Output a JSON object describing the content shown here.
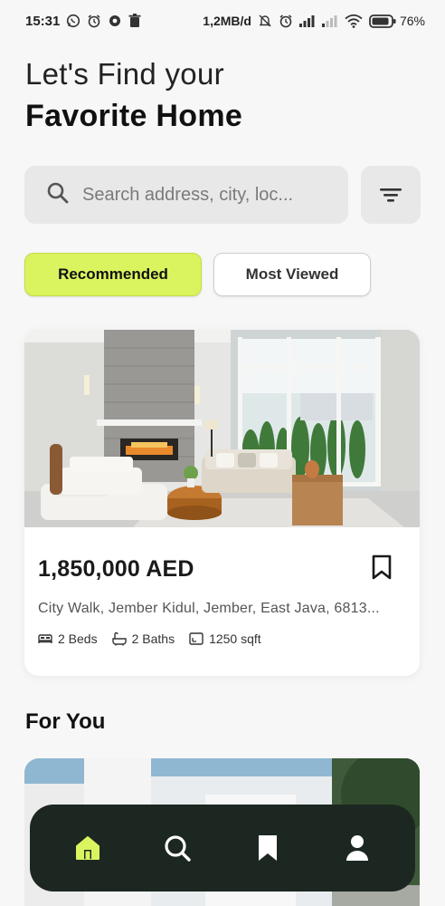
{
  "status_bar": {
    "time": "15:31",
    "net_speed": "1,2MB/d",
    "battery": "76%"
  },
  "headline": {
    "line1": "Let's Find your",
    "line2": "Favorite Home"
  },
  "search": {
    "placeholder": "Search address, city, loc..."
  },
  "tabs": [
    {
      "label": "Recommended",
      "active": true
    },
    {
      "label": "Most Viewed",
      "active": false
    }
  ],
  "property": {
    "price": "1,850,000 AED",
    "address": "City Walk, Jember Kidul, Jember, East Java, 6813...",
    "beds": "2 Beds",
    "baths": "2 Baths",
    "area": "1250 sqft"
  },
  "for_you": {
    "title": "For You"
  },
  "nav": {
    "items": [
      "home-icon",
      "search-icon",
      "bookmark-icon",
      "profile-icon"
    ],
    "active": "home-icon"
  },
  "colors": {
    "accent": "#d9f45e",
    "nav_bg": "#1d2722"
  }
}
